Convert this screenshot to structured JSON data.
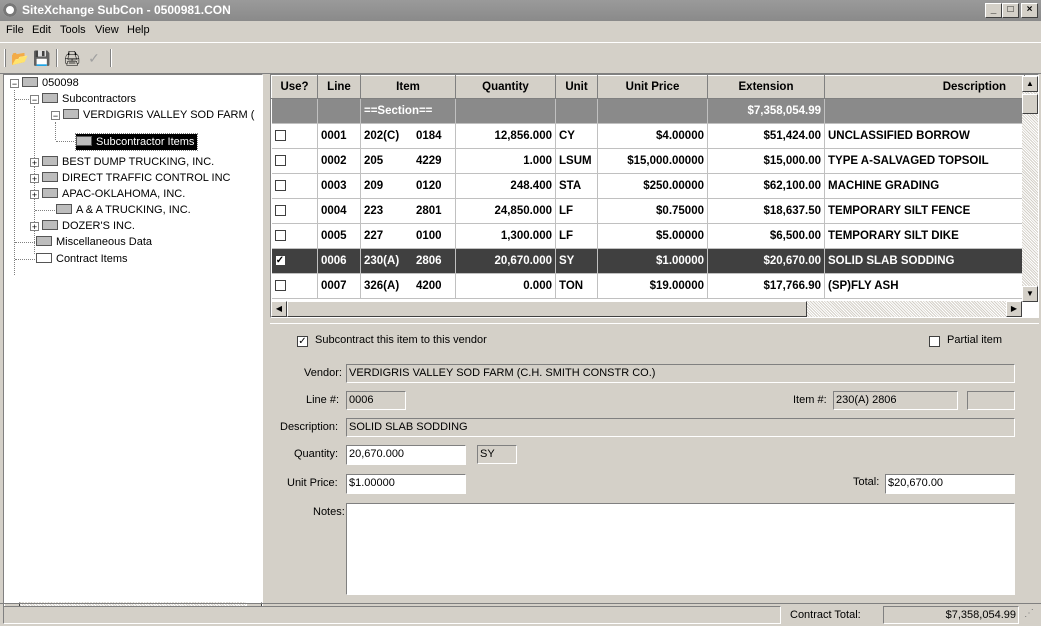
{
  "window": {
    "title": "SiteXchange SubCon - 0500981.CON"
  },
  "menu": [
    "File",
    "Edit",
    "Tools",
    "View",
    "Help"
  ],
  "toolbar": {
    "icons": [
      "open-icon",
      "save-icon",
      "print-icon",
      "check-icon"
    ]
  },
  "tree": {
    "root": "050098",
    "subcontractors": "Subcontractors",
    "vendor1": "VERDIGRIS VALLEY SOD FARM (",
    "subitems": "Subcontractor Items",
    "vendor2": "BEST DUMP TRUCKING, INC.",
    "vendor3": "DIRECT TRAFFIC CONTROL INC",
    "vendor4": "APAC-OKLAHOMA, INC.",
    "vendor5": "A & A TRUCKING, INC.",
    "vendor6": "DOZER'S INC.",
    "misc": "Miscellaneous Data",
    "contract": "Contract Items"
  },
  "grid": {
    "headers": [
      "Use?",
      "Line",
      "Item",
      "Quantity",
      "Unit",
      "Unit Price",
      "Extension",
      "Description"
    ],
    "section": {
      "item": "==Section==",
      "extension": "$7,358,054.99"
    },
    "rows": [
      {
        "checked": false,
        "line": "0001",
        "item": "202(C)",
        "item2": "0184",
        "qty": "12,856.000",
        "unit": "CY",
        "price": "$4.00000",
        "ext": "$51,424.00",
        "desc": "UNCLASSIFIED BORROW"
      },
      {
        "checked": false,
        "line": "0002",
        "item": "205",
        "item2": "4229",
        "qty": "1.000",
        "unit": "LSUM",
        "price": "$15,000.00000",
        "ext": "$15,000.00",
        "desc": "TYPE A-SALVAGED TOPSOIL"
      },
      {
        "checked": false,
        "line": "0003",
        "item": "209",
        "item2": "0120",
        "qty": "248.400",
        "unit": "STA",
        "price": "$250.00000",
        "ext": "$62,100.00",
        "desc": "MACHINE GRADING"
      },
      {
        "checked": false,
        "line": "0004",
        "item": "223",
        "item2": "2801",
        "qty": "24,850.000",
        "unit": "LF",
        "price": "$0.75000",
        "ext": "$18,637.50",
        "desc": "TEMPORARY SILT FENCE"
      },
      {
        "checked": false,
        "line": "0005",
        "item": "227",
        "item2": "0100",
        "qty": "1,300.000",
        "unit": "LF",
        "price": "$5.00000",
        "ext": "$6,500.00",
        "desc": "TEMPORARY SILT DIKE"
      },
      {
        "checked": true,
        "line": "0006",
        "item": "230(A)",
        "item2": "2806",
        "qty": "20,670.000",
        "unit": "SY",
        "price": "$1.00000",
        "ext": "$20,670.00",
        "desc": "SOLID SLAB SODDING"
      },
      {
        "checked": false,
        "line": "0007",
        "item": "326(A)",
        "item2": "4200",
        "qty": "0.000",
        "unit": "TON",
        "price": "$19.00000",
        "ext": "$17,766.90",
        "desc": "(SP)FLY ASH"
      }
    ]
  },
  "detail": {
    "subcontract_label": "Subcontract this item to this vendor",
    "partial_label": "Partial item",
    "vendor_label": "Vendor:",
    "vendor_value": "VERDIGRIS VALLEY SOD FARM (C.H. SMITH CONSTR CO.)",
    "line_label": "Line #:",
    "line_value": "0006",
    "item_label": "Item #:",
    "item_value": "230(A)  2806",
    "desc_label": "Description:",
    "desc_value": "SOLID SLAB SODDING",
    "qty_label": "Quantity:",
    "qty_value": "20,670.000",
    "unit_value": "SY",
    "price_label": "Unit Price:",
    "price_value": "$1.00000",
    "total_label": "Total:",
    "total_value": "$20,670.00",
    "notes_label": "Notes:"
  },
  "status": {
    "contract_total_label": "Contract Total:",
    "contract_total_value": "$7,358,054.99"
  }
}
